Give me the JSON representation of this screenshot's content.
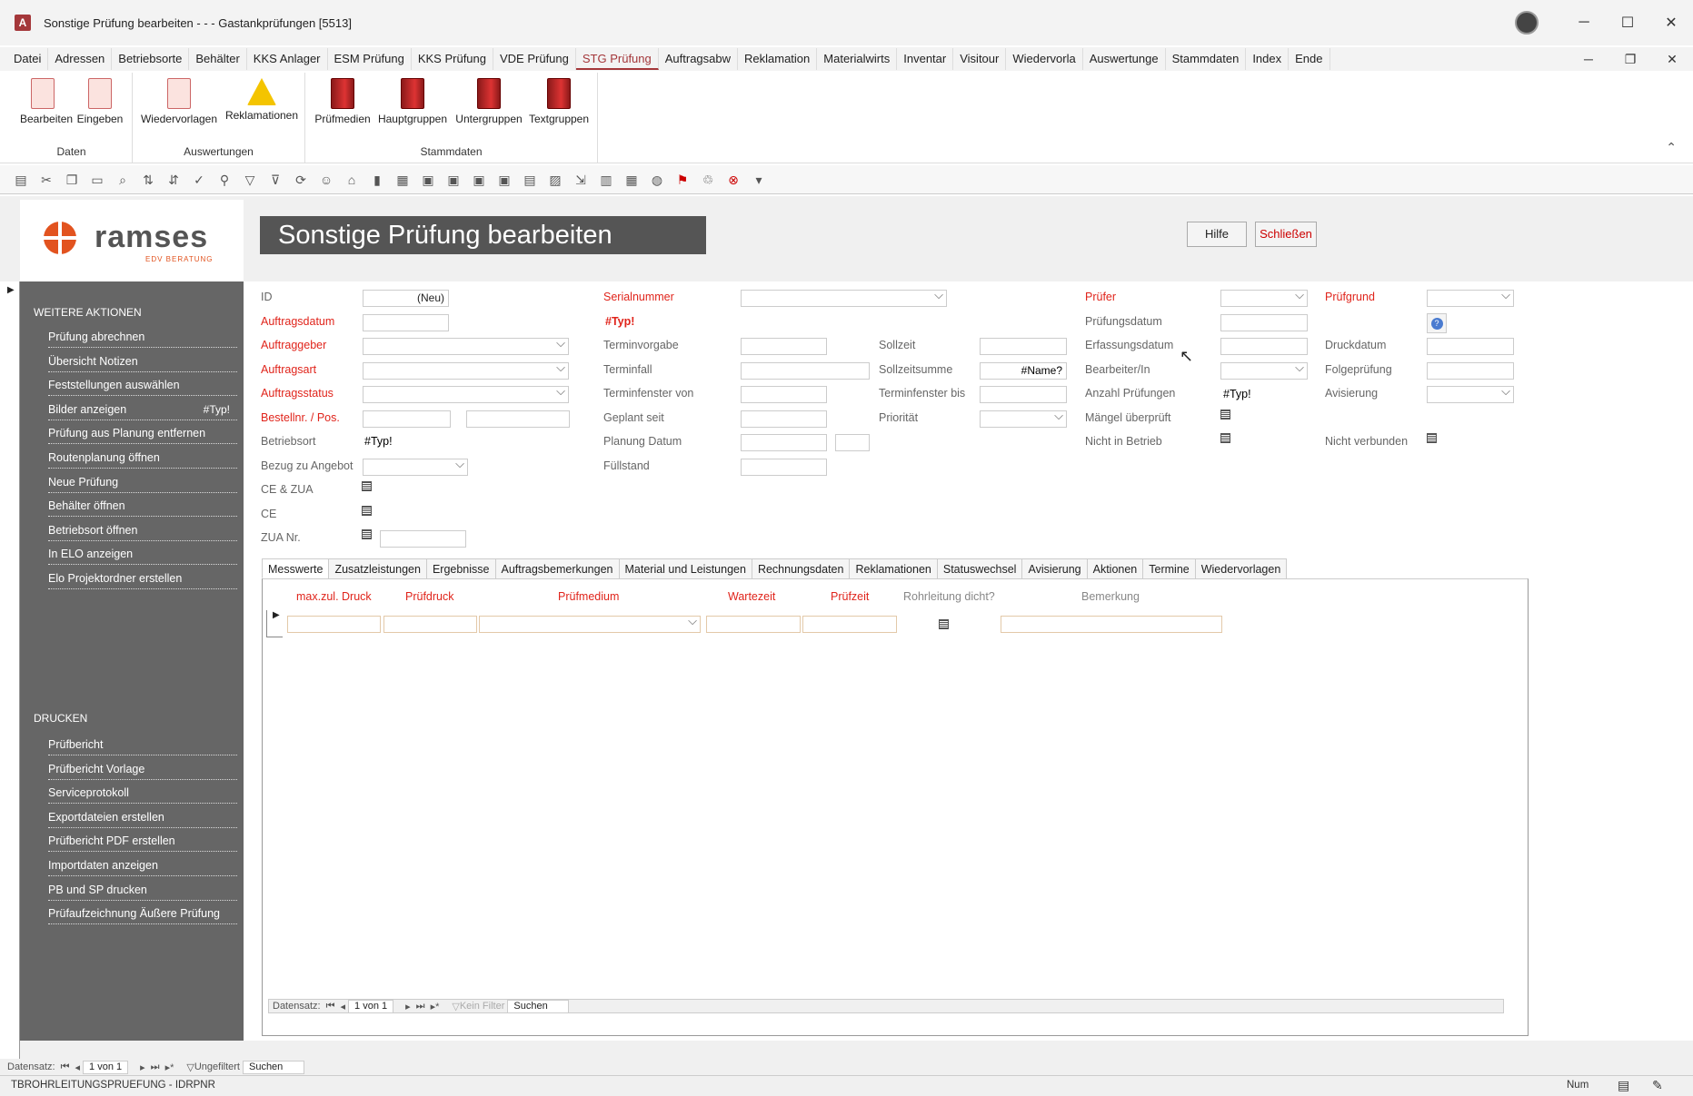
{
  "window": {
    "title": "Sonstige Prüfung bearbeiten -  -  -  Gastankprüfungen [5513]"
  },
  "menu": [
    "Datei",
    "Adressen",
    "Betriebsorte",
    "Behälter",
    "KKS Anlager",
    "ESM Prüfung",
    "KKS Prüfung",
    "VDE Prüfung",
    "STG Prüfung",
    "Auftragsabw",
    "Reklamation",
    "Materialwirts",
    "Inventar",
    "Visitour",
    "Wiedervorla",
    "Auswertunge",
    "Stammdaten",
    "Index",
    "Ende"
  ],
  "ribbon": {
    "daten": {
      "label": "Daten",
      "buttons": [
        "Bearbeiten",
        "Eingeben"
      ]
    },
    "auswertungen": {
      "label": "Auswertungen",
      "buttons": [
        "Wiedervorlagen",
        "Reklamationen"
      ]
    },
    "stammdaten": {
      "label": "Stammdaten",
      "buttons": [
        "Prüfmedien",
        "Hauptgruppen",
        "Untergruppen",
        "Textgruppen"
      ]
    }
  },
  "logo": {
    "name": "ramses",
    "sub": "EDV BERATUNG"
  },
  "form": {
    "title": "Sonstige Prüfung bearbeiten",
    "hilfe": "Hilfe",
    "schliessen": "Schließen"
  },
  "sidebar": {
    "weitere_head": "WEITERE AKTIONEN",
    "weitere": [
      "Prüfung abrechnen",
      "Übersicht Notizen",
      "Feststellungen auswählen",
      "Bilder anzeigen",
      "Prüfung aus Planung entfernen",
      "Routenplanung öffnen",
      "Neue Prüfung",
      "Behälter öffnen",
      "Betriebsort öffnen",
      "In ELO anzeigen",
      "Elo Projektordner erstellen"
    ],
    "bilder_tag": "#Typ!",
    "drucken_head": "DRUCKEN",
    "drucken": [
      "Prüfbericht",
      "Prüfbericht Vorlage",
      "Serviceprotokoll",
      "Exportdateien erstellen",
      "Prüfbericht PDF erstellen",
      "Importdaten anzeigen",
      "PB und SP drucken",
      "Prüfaufzeichnung Äußere Prüfung"
    ]
  },
  "fields": {
    "id": "ID",
    "id_val": "(Neu)",
    "auftragsdatum": "Auftragsdatum",
    "auftraggeber": "Auftraggeber",
    "auftragsart": "Auftragsart",
    "auftragsstatus": "Auftragsstatus",
    "bestellnr": "Bestellnr. / Pos.",
    "betriebsort": "Betriebsort",
    "betriebsort_val": "#Typ!",
    "bezug": "Bezug zu Angebot",
    "ce_zua": "CE & ZUA",
    "ce": "CE",
    "zua_nr": "ZUA Nr.",
    "serialnummer": "Serialnummer",
    "typ_err": "#Typ!",
    "terminvorgabe": "Terminvorgabe",
    "terminfall": "Terminfall",
    "terminfenster_von": "Terminfenster von",
    "geplant_seit": "Geplant seit",
    "planung_datum": "Planung Datum",
    "fuellstand": "Füllstand",
    "sollzeit": "Sollzeit",
    "sollzeitsumme": "Sollzeitsumme",
    "sollzeitsumme_val": "#Name?",
    "terminfenster_bis": "Terminfenster bis",
    "prioritaet": "Priorität",
    "pruefer": "Prüfer",
    "pruefungsdatum": "Prüfungsdatum",
    "erfassungsdatum": "Erfassungsdatum",
    "bearbeiter": "Bearbeiter/In",
    "anzahl": "Anzahl Prüfungen",
    "anzahl_val": "#Typ!",
    "maengel": "Mängel überprüft",
    "nicht_betrieb": "Nicht in Betrieb",
    "pruefgrund": "Prüfgrund",
    "druckdatum": "Druckdatum",
    "folgepruefung": "Folgeprüfung",
    "avisierung": "Avisierung",
    "nicht_verbunden": "Nicht verbunden"
  },
  "tabs": [
    "Messwerte",
    "Zusatzleistungen",
    "Ergebnisse",
    "Auftragsbemerkungen",
    "Material und Leistungen",
    "Rechnungsdaten",
    "Reklamationen",
    "Statuswechsel",
    "Avisierung",
    "Aktionen",
    "Termine",
    "Wiedervorlagen"
  ],
  "grid": {
    "headers": [
      "max.zul. Druck",
      "Prüfdruck",
      "Prüfmedium",
      "Wartezeit",
      "Prüfzeit",
      "Rohrleitung dicht?",
      "Bemerkung"
    ]
  },
  "inner_nav": {
    "label": "Datensatz:",
    "pos": "1 von 1",
    "filter": "Kein Filter",
    "search": "Suchen"
  },
  "outer_nav": {
    "label": "Datensatz:",
    "pos": "1 von 1",
    "filter": "Ungefiltert",
    "search": "Suchen"
  },
  "status": {
    "left": "TBROHRLEITUNGSPRUEFUNG - IDRPNR",
    "num": "Num"
  }
}
